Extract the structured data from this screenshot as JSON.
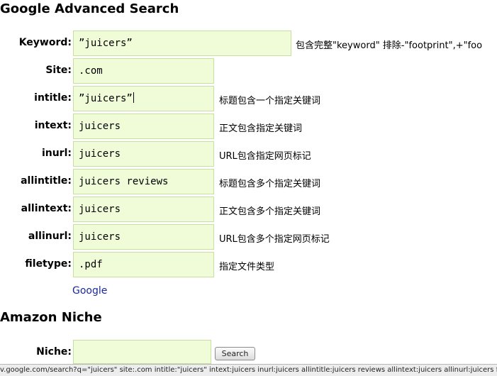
{
  "advanced": {
    "title": "Google Advanced Search",
    "rows": [
      {
        "label": "Keyword:",
        "value": "”juicers”",
        "hint": "包含完整\"keyword\" 排除-\"footprint\",+\"foo"
      },
      {
        "label": "Site:",
        "value": ".com",
        "hint": ""
      },
      {
        "label": "intitle:",
        "value": "”juicers”",
        "hint": "标题包含一个指定关键词"
      },
      {
        "label": "intext:",
        "value": "juicers",
        "hint": "正文包含指定关键词"
      },
      {
        "label": "inurl:",
        "value": "juicers",
        "hint": "URL包含指定网页标记"
      },
      {
        "label": "allintitle:",
        "value": "juicers reviews",
        "hint": "标题包含多个指定关键词"
      },
      {
        "label": "allintext:",
        "value": "juicers",
        "hint": "正文包含多个指定关键词"
      },
      {
        "label": "allinurl:",
        "value": "juicers",
        "hint": "URL包含多个指定网页标记"
      },
      {
        "label": "filetype:",
        "value": ".pdf",
        "hint": "指定文件类型"
      }
    ],
    "google_link": "Google"
  },
  "amazon": {
    "title": "Amazon Niche",
    "niche_label": "Niche:",
    "niche_value": "",
    "search_button": "Search"
  },
  "status_bar": {
    "text": "v.google.com/search?q=\"juicers\" site:.com intitle:\"juicers\" intext:juicers inurl:juicers allintitle:juicers reviews allintext:juicers allinurl:juicers filetype:.pdf"
  }
}
